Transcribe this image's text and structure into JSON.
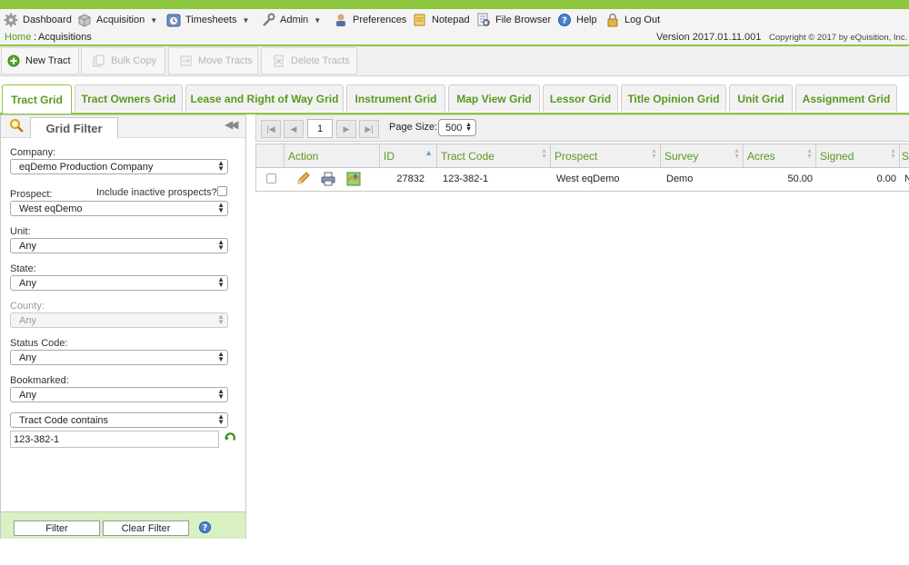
{
  "menu": {
    "items": [
      {
        "label": "Dashboard",
        "icon": "gear-icon"
      },
      {
        "label": "Acquisition",
        "icon": "box-icon",
        "dropdown": true
      },
      {
        "label": "Timesheets",
        "icon": "clock-icon",
        "dropdown": true
      },
      {
        "label": "Admin",
        "icon": "wrench-icon",
        "dropdown": true
      },
      {
        "label": "Preferences",
        "icon": "user-icon"
      },
      {
        "label": "Notepad",
        "icon": "notepad-icon"
      },
      {
        "label": "File Browser",
        "icon": "file-browser-icon"
      },
      {
        "label": "Help",
        "icon": "help-icon"
      },
      {
        "label": "Log Out",
        "icon": "lock-icon"
      }
    ]
  },
  "breadcrumb": {
    "home": "Home",
    "separator": ":",
    "current": "Acquisitions"
  },
  "version": "Version 2017.01.11.001",
  "copyright": "Copyright © 2017  by eQuisition, Inc.",
  "toolbar": {
    "new_tract": "New Tract",
    "bulk_copy": "Bulk Copy",
    "move_tracts": "Move Tracts",
    "delete_tracts": "Delete Tracts"
  },
  "tabs": [
    {
      "label": "Tract Grid",
      "active": true
    },
    {
      "label": "Tract Owners Grid"
    },
    {
      "label": "Lease and Right of Way Grid"
    },
    {
      "label": "Instrument Grid"
    },
    {
      "label": "Map View Grid"
    },
    {
      "label": "Lessor Grid"
    },
    {
      "label": "Title Opinion Grid"
    },
    {
      "label": "Unit Grid"
    },
    {
      "label": "Assignment Grid"
    }
  ],
  "filter": {
    "title": "Grid Filter",
    "company_label": "Company:",
    "company_value": "eqDemo Production Company",
    "prospect_label": "Prospect:",
    "include_inactive_label": "Include inactive prospects?",
    "prospect_value": "West eqDemo",
    "unit_label": "Unit:",
    "unit_value": "Any",
    "state_label": "State:",
    "state_value": "Any",
    "county_label": "County:",
    "county_value": "Any",
    "status_label": "Status Code:",
    "status_value": "Any",
    "bookmarked_label": "Bookmarked:",
    "bookmarked_value": "Any",
    "search_field": "Tract Code contains",
    "search_value": "123-382-1",
    "filter_button": "Filter",
    "clear_button": "Clear Filter"
  },
  "pager": {
    "page": "1",
    "page_size_label": "Page Size:",
    "page_size": "500"
  },
  "grid": {
    "columns": [
      "Action",
      "ID",
      "Tract Code",
      "Prospect",
      "Survey",
      "Acres",
      "Signed",
      "S"
    ],
    "row": {
      "id": "27832",
      "tract_code": "123-382-1",
      "prospect": "West eqDemo",
      "survey": "Demo",
      "acres": "50.00",
      "signed": "0.00",
      "last": "N"
    }
  },
  "colors": {
    "accent": "#8dc63f",
    "link": "#5a9a1e"
  }
}
